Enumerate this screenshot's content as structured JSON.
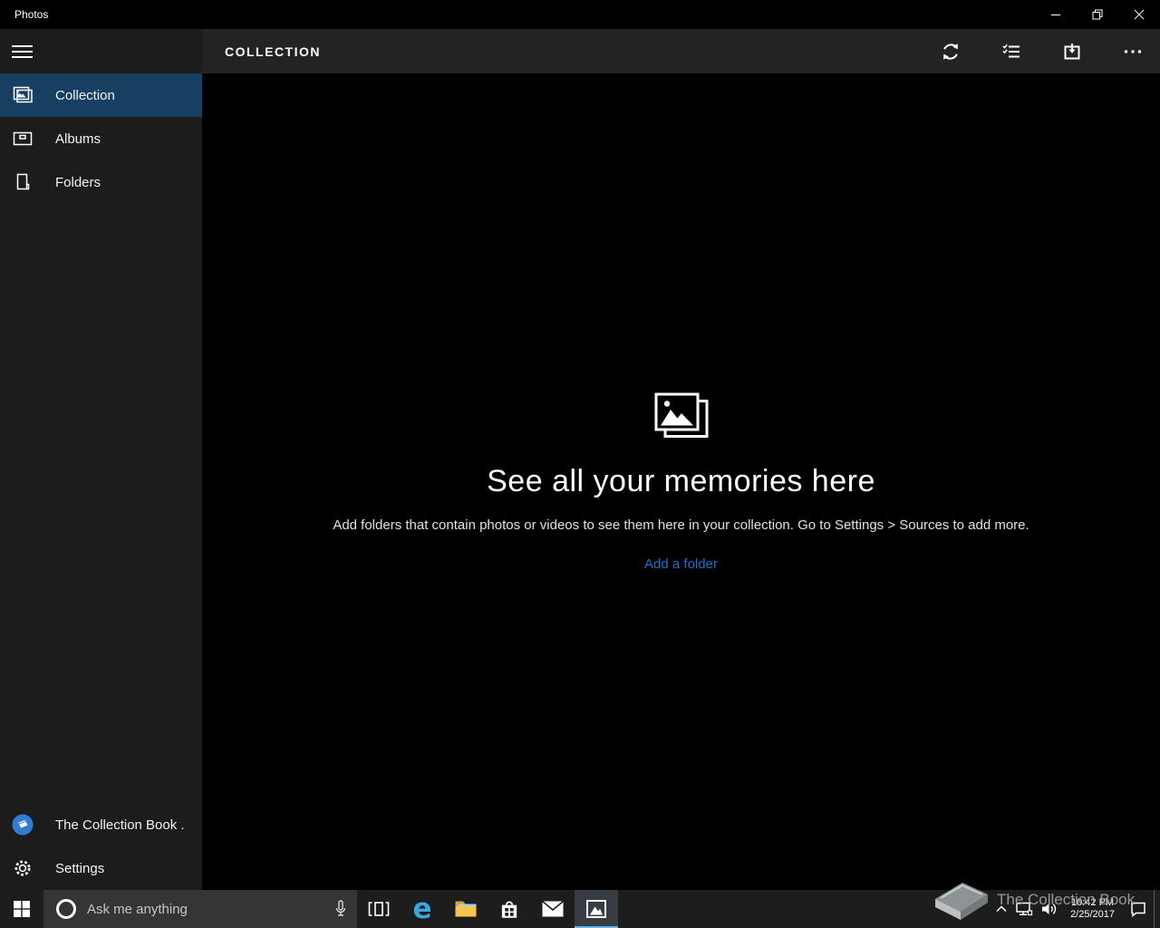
{
  "window": {
    "title": "Photos"
  },
  "sidebar": {
    "items": [
      {
        "label": "Collection",
        "selected": true
      },
      {
        "label": "Albums",
        "selected": false
      },
      {
        "label": "Folders",
        "selected": false
      }
    ],
    "account_name": "The Collection Book .",
    "settings_label": "Settings"
  },
  "header": {
    "title": "COLLECTION"
  },
  "empty_state": {
    "title": "See all your memories here",
    "description": "Add folders that contain photos or videos to see them here in your collection. Go to Settings > Sources to add more.",
    "link_label": "Add a folder"
  },
  "taskbar": {
    "search_placeholder": "Ask me anything",
    "clock": {
      "time": "10:42 PM",
      "date": "2/25/2017"
    }
  },
  "watermark": {
    "text": "The Collection Book"
  },
  "icons": {
    "hamburger": "menu",
    "collection": "stacked-photos",
    "albums": "album-frame",
    "folders": "folder-page",
    "account": "blue-book-avatar",
    "settings": "gear",
    "header_actions": [
      "refresh",
      "select-checklist",
      "import-tray",
      "more-ellipsis"
    ],
    "window_controls": [
      "minimize",
      "restore",
      "close"
    ],
    "taskbar_items": [
      "start",
      "cortana-search",
      "microphone",
      "task-view",
      "edge",
      "file-explorer",
      "store",
      "mail",
      "photos-active"
    ],
    "tray_items": [
      "chevron-up",
      "network",
      "volume",
      "clock",
      "action-center"
    ]
  },
  "colors": {
    "titlebar": "#000000",
    "sidebar": "#1c1c1c",
    "header_strip": "#232323",
    "selected_nav": "#173f61",
    "link_blue": "#1673c8",
    "taskbar": "#1d1d1d",
    "active_underline": "#6cb2e8",
    "avatar_blue": "#2e7dd1"
  }
}
